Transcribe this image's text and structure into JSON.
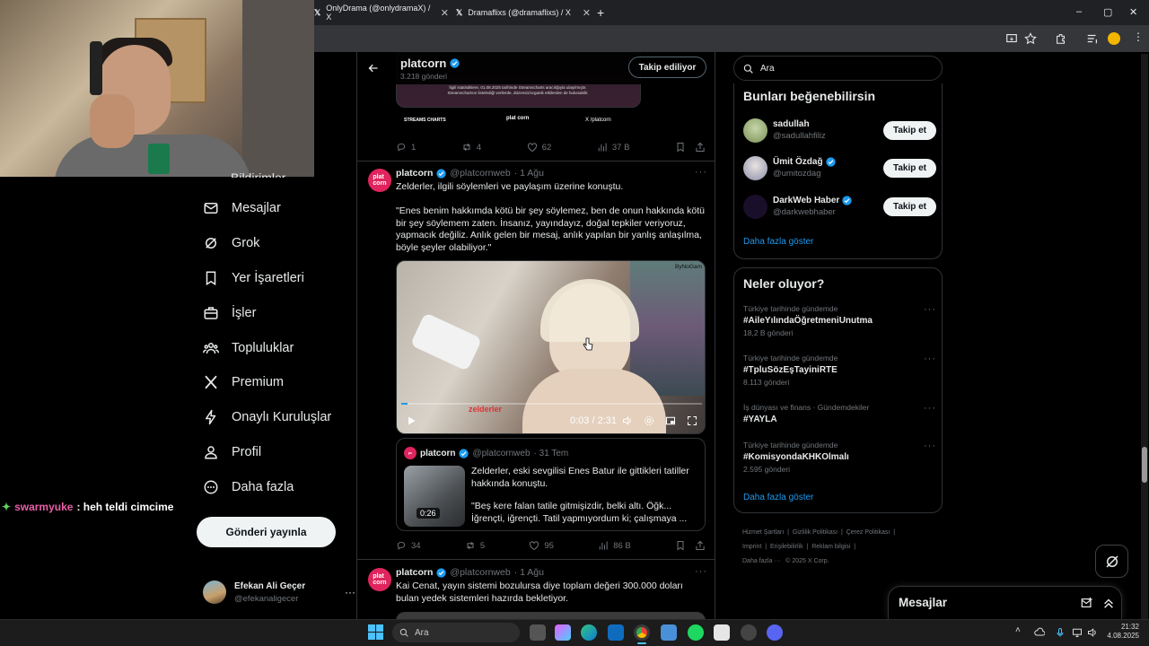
{
  "browser": {
    "tabs": [
      {
        "title": "OnlyDrama (@onlydramaX) / X"
      },
      {
        "title": "Dramaflixs (@dramaflixs) / X"
      }
    ],
    "new_tab": "+",
    "window_controls": {
      "minimize": "–",
      "maximize": "▢",
      "close": "✕"
    }
  },
  "stream_chat": {
    "username": "swarmyuke",
    "message": ": heh teldi cimcime"
  },
  "nav": {
    "partial_item": "Bildirimler",
    "items": [
      {
        "label": "Mesajlar",
        "icon": "mail-icon"
      },
      {
        "label": "Grok",
        "icon": "grok-icon"
      },
      {
        "label": "Yer İşaretleri",
        "icon": "bookmark-icon"
      },
      {
        "label": "İşler",
        "icon": "briefcase-icon"
      },
      {
        "label": "Topluluklar",
        "icon": "communities-icon"
      },
      {
        "label": "Premium",
        "icon": "x-logo-icon"
      },
      {
        "label": "Onaylı Kuruluşlar",
        "icon": "lightning-icon"
      },
      {
        "label": "Profil",
        "icon": "person-icon"
      },
      {
        "label": "Daha fazla",
        "icon": "more-circle-icon"
      }
    ],
    "post_button": "Gönderi yayınla",
    "account": {
      "name": "Efekan Ali Geçer",
      "handle": "@efekanaligecer",
      "more": "···"
    }
  },
  "timeline": {
    "header": {
      "title": "platcorn",
      "subtitle": "3.218 gönderi",
      "follow_state": "Takip ediliyor"
    },
    "top_tweet_media": {
      "caption_line1": "İlgili istatistiklere, 01.08.2025 tarihinde Streamscharts aracılığıyla ulaşılmıştır.",
      "caption_line2": "Streamschartsın listelediği verilerde, düzensiz/organik etkilerden de bulunabilir.",
      "logo_left": "STREAMS CHARTS",
      "logo_mid": "plat corn",
      "logo_right": "X /platcorn"
    },
    "top_tweet_actions": {
      "replies": "1",
      "reposts": "4",
      "likes": "62",
      "views": "37 B"
    },
    "tweet1": {
      "name": "platcorn",
      "handle": "@platcornweb",
      "time": "· 1 Ağu",
      "text1": "Zelderler, ilgili söylemleri ve paylaşım üzerine konuştu.",
      "quote": "\"Enes benim hakkımda kötü bir şey söylemez, ben de onun hakkında kötü bir şey söylemem zaten. İnsanız, yayındayız, doğal tepkiler veriyoruz, yapmacık değiliz. Anlık gelen bir mesaj, anlık yapılan bir yanlış anlaşılma, böyle şeyler olabiliyor.\"",
      "video": {
        "time": "0:03 / 2:31",
        "watermark": "zelderler",
        "corner": "ByNoGam"
      },
      "quoted": {
        "name": "platcorn",
        "handle": "@platcornweb",
        "time": "· 31 Tem",
        "text": "Zelderler, eski sevgilisi Enes Batur ile gittikleri tatiller hakkında konuştu.",
        "text2": "\"Beş kere falan tatile gitmişizdir, belki altı. Öğk... İğrençti, iğrençti. Tatil yapmıyordum ki; çalışmaya ...",
        "thumb_duration": "0:26"
      },
      "actions": {
        "replies": "34",
        "reposts": "5",
        "likes": "95",
        "views": "86 B"
      }
    },
    "tweet2": {
      "name": "platcorn",
      "handle": "@platcornweb",
      "time": "· 1 Ağu",
      "text": "Kai Cenat, yayın sistemi bozulursa diye toplam değeri 300.000 doları bulan yedek sistemleri hazırda bekletiyor."
    },
    "more": "···"
  },
  "sidebar": {
    "search_placeholder": "Ara",
    "suggestions": {
      "title": "Bunları beğenebilirsin",
      "users": [
        {
          "name": "sadullah",
          "handle": "@sadullahfiliz",
          "button": "Takip et"
        },
        {
          "name": "Ümit Özdağ",
          "handle": "@umitozdag",
          "button": "Takip et"
        },
        {
          "name": "DarkWeb Haber",
          "handle": "@darkwebhaber",
          "button": "Takip et"
        }
      ],
      "show_more": "Daha fazla göster"
    },
    "trends": {
      "title": "Neler oluyor?",
      "items": [
        {
          "meta": "Türkiye tarihinde gündemde",
          "tag": "#AileYılındaÖğretmeniUnutma",
          "count": "18,2 B gönderi"
        },
        {
          "meta": "Türkiye tarihinde gündemde",
          "tag": "#TpluSözEşTayiniRTE",
          "count": "8.113 gönderi"
        },
        {
          "meta": "İş dünyası ve finans · Gündemdekiler",
          "tag": "#YAYLA",
          "count": ""
        },
        {
          "meta": "Türkiye tarihinde gündemde",
          "tag": "#KomisyondaKHKOlmalı",
          "count": "2.595 gönderi"
        }
      ],
      "show_more": "Daha fazla göster"
    },
    "footer": {
      "links": [
        "Hizmet Şartları",
        "Gizlilik Politikası",
        "Çerez Politikası",
        "Imprint",
        "Erişilebilirlik",
        "Reklam bilgisi",
        "Daha fazla ···"
      ],
      "copyright": "© 2025 X Corp."
    },
    "messages_drawer": {
      "title": "Mesajlar"
    }
  },
  "taskbar": {
    "search_placeholder": "Ara",
    "time": "21:32",
    "date": "4.08.2025"
  },
  "colors": {
    "accent": "#1d9bf0",
    "background": "#000000",
    "border": "#2f3336",
    "muted": "#71767b"
  }
}
